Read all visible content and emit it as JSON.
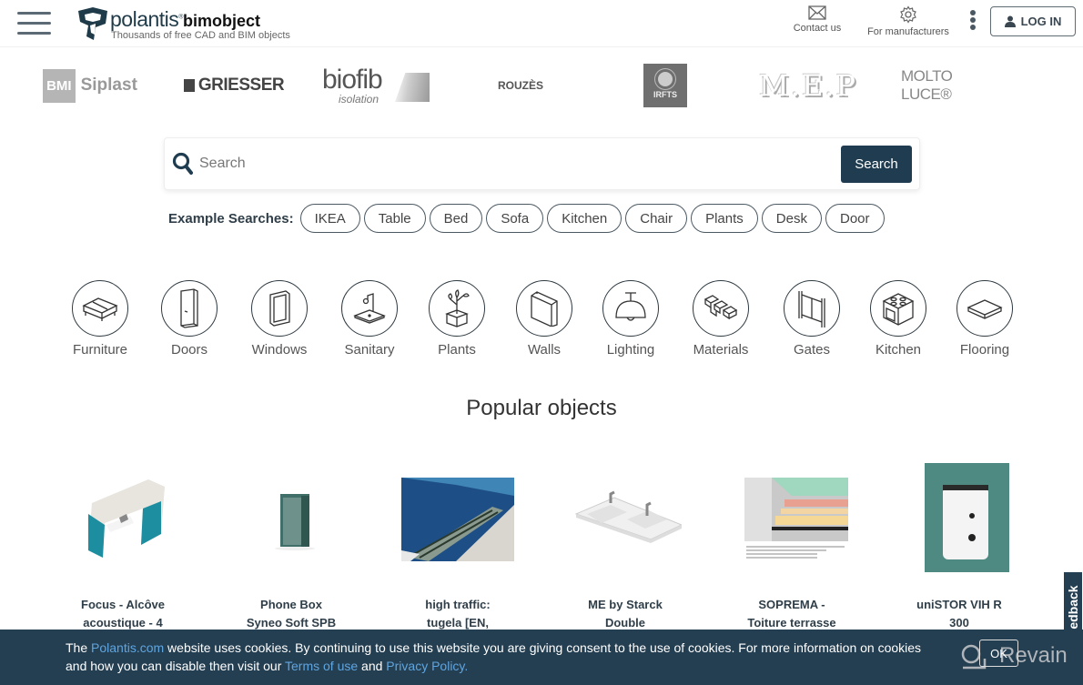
{
  "header": {
    "logo_name": "polantis",
    "logo_sub": "bimobject",
    "tagline": "Thousands of free CAD and BIM objects",
    "contact_label": "Contact us",
    "manufacturers_label": "For manufacturers",
    "login_label": "LOG IN"
  },
  "brands": {
    "siplast_bmi": "BMI",
    "siplast_name": "Siplast",
    "griesser": "GRIESSER",
    "biofib": "biofib",
    "biofib_sub": "isolation",
    "rouzes": "ROUZÈS",
    "irfts": "IRFTS",
    "mep": "M.E.P",
    "molto_luce": "MOLTO LUCE®"
  },
  "search": {
    "placeholder": "Search",
    "button_label": "Search",
    "examples_label": "Example Searches:",
    "examples": [
      "IKEA",
      "Table",
      "Bed",
      "Sofa",
      "Kitchen",
      "Chair",
      "Plants",
      "Desk",
      "Door"
    ]
  },
  "categories": [
    "Furniture",
    "Doors",
    "Windows",
    "Sanitary",
    "Plants",
    "Walls",
    "Lighting",
    "Materials",
    "Gates",
    "Kitchen",
    "Flooring"
  ],
  "popular": {
    "title": "Popular objects",
    "items": [
      {
        "line1": "Focus - Alcôve",
        "line2": "acoustique - 4"
      },
      {
        "line1": "Phone Box",
        "line2": "Syneo Soft SPB"
      },
      {
        "line1": "high traffic:",
        "line2": "tugela [EN,"
      },
      {
        "line1": "ME by Starck",
        "line2": "Double"
      },
      {
        "line1": "SOPREMA -",
        "line2": "Toiture terrasse"
      },
      {
        "line1": "uniSTOR VIH R",
        "line2": "300"
      }
    ]
  },
  "cookie": {
    "t1": "The ",
    "link_site": "Polantis.com",
    "t2": " website uses cookies. By continuing to use this website you are giving consent to the use of cookies. For more information on cookies",
    "t3": "and how you can disable then visit our ",
    "link_terms": "Terms of use",
    "t4": " and ",
    "link_privacy": "Privacy Policy.",
    "ok_label": "OK"
  },
  "watermark": "Revain",
  "feedback_label": "Feedback"
}
